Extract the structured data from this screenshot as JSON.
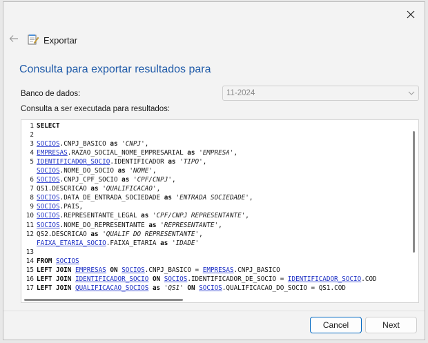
{
  "header": {
    "title": "Exportar",
    "back_icon": "arrow-left-icon",
    "app_icon": "notepad-icon",
    "close_icon": "close-icon"
  },
  "main": {
    "heading": "Consulta para exportar resultados para",
    "db_label": "Banco de dados:",
    "db_value": "11-2024",
    "query_label": "Consulta a ser executada para resultados:"
  },
  "editor": {
    "lines": [
      {
        "n": "1",
        "parts": [
          [
            "k",
            "SELECT"
          ]
        ]
      },
      {
        "n": "2",
        "parts": []
      },
      {
        "n": "3",
        "parts": [
          [
            "t",
            "SOCIOS"
          ],
          [
            "p",
            ".CNPJ_BASICO "
          ],
          [
            "k",
            "as"
          ],
          [
            "p",
            " "
          ],
          [
            "s",
            "'CNPJ'"
          ],
          [
            "p",
            ","
          ]
        ]
      },
      {
        "n": "4",
        "parts": [
          [
            "t",
            "EMPRESAS"
          ],
          [
            "p",
            ".RAZAO_SOCIAL_NOME_EMPRESARIAL "
          ],
          [
            "k",
            "as"
          ],
          [
            "p",
            " "
          ],
          [
            "s",
            "'EMPRESA'"
          ],
          [
            "p",
            ","
          ]
        ]
      },
      {
        "n": "5",
        "parts": [
          [
            "t",
            "IDENTIFICADOR_SOCIO"
          ],
          [
            "p",
            ".IDENTIFICADOR "
          ],
          [
            "k",
            "as"
          ],
          [
            "p",
            " "
          ],
          [
            "s",
            "'TIPO'"
          ],
          [
            "p",
            ","
          ]
        ]
      },
      {
        "n": "",
        "parts": [
          [
            "t",
            "SOCIOS"
          ],
          [
            "p",
            ".NOME_DO_SOCIO "
          ],
          [
            "k",
            "as"
          ],
          [
            "p",
            " "
          ],
          [
            "s",
            "'NOME'"
          ],
          [
            "p",
            ","
          ]
        ]
      },
      {
        "n": "6",
        "parts": [
          [
            "t",
            "SOCIOS"
          ],
          [
            "p",
            ".CNPJ_CPF_SOCIO "
          ],
          [
            "k",
            "as"
          ],
          [
            "p",
            " "
          ],
          [
            "s",
            "'CPF/CNPJ'"
          ],
          [
            "p",
            ","
          ]
        ]
      },
      {
        "n": "7",
        "parts": [
          [
            "p",
            "QS1.DESCRICAO "
          ],
          [
            "k",
            "as"
          ],
          [
            "p",
            " "
          ],
          [
            "s",
            "'QUALIFICACAO'"
          ],
          [
            "p",
            ","
          ]
        ]
      },
      {
        "n": "8",
        "parts": [
          [
            "t",
            "SOCIOS"
          ],
          [
            "p",
            ".DATA_DE_ENTRADA_SOCIEDADE "
          ],
          [
            "k",
            "as"
          ],
          [
            "p",
            " "
          ],
          [
            "s",
            "'ENTRADA SOCIEDADE'"
          ],
          [
            "p",
            ","
          ]
        ]
      },
      {
        "n": "9",
        "parts": [
          [
            "t",
            "SOCIOS"
          ],
          [
            "p",
            ".PAIS,"
          ]
        ]
      },
      {
        "n": "10",
        "parts": [
          [
            "t",
            "SOCIOS"
          ],
          [
            "p",
            ".REPRESENTANTE_LEGAL "
          ],
          [
            "k",
            "as"
          ],
          [
            "p",
            " "
          ],
          [
            "s",
            "'CPF/CNPJ REPRESENTANTE'"
          ],
          [
            "p",
            ","
          ]
        ]
      },
      {
        "n": "11",
        "parts": [
          [
            "t",
            "SOCIOS"
          ],
          [
            "p",
            ".NOME_DO_REPRESENTANTE "
          ],
          [
            "k",
            "as"
          ],
          [
            "p",
            " "
          ],
          [
            "s",
            "'REPRESENTANTE'"
          ],
          [
            "p",
            ","
          ]
        ]
      },
      {
        "n": "12",
        "parts": [
          [
            "p",
            "QS2.DESCRICAO "
          ],
          [
            "k",
            "as"
          ],
          [
            "p",
            " "
          ],
          [
            "s",
            "'QUALIF DO REPRESENTANTE'"
          ],
          [
            "p",
            ","
          ]
        ]
      },
      {
        "n": "",
        "parts": [
          [
            "t",
            "FAIXA_ETARIA_SOCIO"
          ],
          [
            "p",
            ".FAIXA_ETARIA "
          ],
          [
            "k",
            "as"
          ],
          [
            "p",
            " "
          ],
          [
            "s",
            "'IDADE'"
          ]
        ]
      },
      {
        "n": "13",
        "parts": []
      },
      {
        "n": "14",
        "parts": [
          [
            "k",
            "FROM"
          ],
          [
            "p",
            " "
          ],
          [
            "t",
            "SOCIOS"
          ]
        ]
      },
      {
        "n": "15",
        "parts": [
          [
            "k",
            "LEFT JOIN"
          ],
          [
            "p",
            " "
          ],
          [
            "t",
            "EMPRESAS"
          ],
          [
            "p",
            " "
          ],
          [
            "k",
            "ON"
          ],
          [
            "p",
            " "
          ],
          [
            "t",
            "SOCIOS"
          ],
          [
            "p",
            ".CNPJ_BASICO = "
          ],
          [
            "t",
            "EMPRESAS"
          ],
          [
            "p",
            ".CNPJ_BASICO"
          ]
        ]
      },
      {
        "n": "16",
        "parts": [
          [
            "k",
            "LEFT JOIN"
          ],
          [
            "p",
            " "
          ],
          [
            "t",
            "IDENTIFICADOR_SOCIO"
          ],
          [
            "p",
            " "
          ],
          [
            "k",
            "ON"
          ],
          [
            "p",
            " "
          ],
          [
            "t",
            "SOCIOS"
          ],
          [
            "p",
            ".IDENTIFICADOR_DE_SOCIO = "
          ],
          [
            "t",
            "IDENTIFICADOR_SOCIO"
          ],
          [
            "p",
            ".COD"
          ]
        ]
      },
      {
        "n": "17",
        "parts": [
          [
            "k",
            "LEFT JOIN"
          ],
          [
            "p",
            " "
          ],
          [
            "t",
            "QUALIFICACAO_SOCIOS"
          ],
          [
            "p",
            " "
          ],
          [
            "k",
            "as"
          ],
          [
            "p",
            " "
          ],
          [
            "s",
            "'QS1'"
          ],
          [
            "p",
            " "
          ],
          [
            "k",
            "ON"
          ],
          [
            "p",
            " "
          ],
          [
            "t",
            "SOCIOS"
          ],
          [
            "p",
            ".QUALIFICACAO_DO_SOCIO = QS1.COD"
          ]
        ]
      }
    ]
  },
  "footer": {
    "cancel_label": "Cancel",
    "next_label": "Next"
  }
}
